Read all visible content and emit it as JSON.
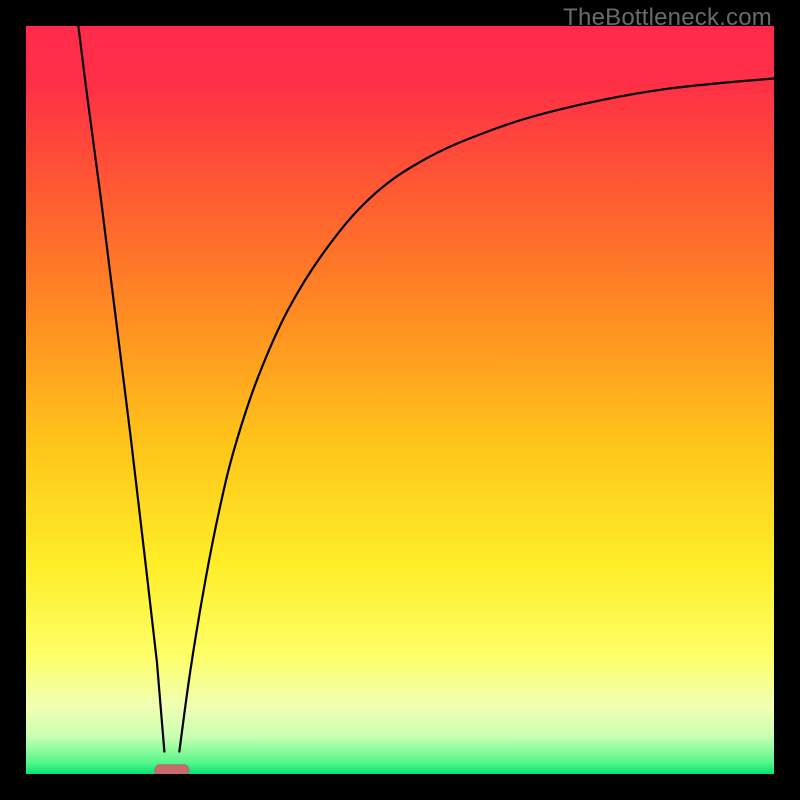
{
  "watermark": "TheBottleneck.com",
  "colors": {
    "frame": "#000000",
    "curve": "#000000",
    "marker_fill": "#c96a6d",
    "marker_stroke": "#a97067",
    "gradient_stops": [
      {
        "offset": "0%",
        "color": "#ff2a4c"
      },
      {
        "offset": "8%",
        "color": "#ff3046"
      },
      {
        "offset": "22%",
        "color": "#ff5a32"
      },
      {
        "offset": "38%",
        "color": "#ff8a23"
      },
      {
        "offset": "55%",
        "color": "#ffc21a"
      },
      {
        "offset": "72%",
        "color": "#ffee28"
      },
      {
        "offset": "84%",
        "color": "#feff66"
      },
      {
        "offset": "91%",
        "color": "#f1ffb4"
      },
      {
        "offset": "95%",
        "color": "#c8ffb1"
      },
      {
        "offset": "98.5%",
        "color": "#55f58a"
      },
      {
        "offset": "100%",
        "color": "#00e572"
      }
    ]
  },
  "chart_data": {
    "type": "line",
    "title": "",
    "xlabel": "",
    "ylabel": "",
    "xlim": [
      0,
      100
    ],
    "ylim": [
      0,
      100
    ],
    "legend": false,
    "annotations": [
      "TheBottleneck.com"
    ],
    "marker": {
      "x": 19.5,
      "y": 0.5,
      "shape": "rounded-pill"
    },
    "series": [
      {
        "name": "left-branch",
        "comment": "Steep descending line from top-left toward the minimum pill",
        "x": [
          7,
          8,
          10,
          12,
          14,
          16,
          17.5,
          18.5
        ],
        "y": [
          100,
          92,
          77,
          61,
          45,
          28,
          15,
          3
        ]
      },
      {
        "name": "right-branch",
        "comment": "Rising saturating curve from the minimum toward upper-right",
        "x": [
          20.5,
          22,
          24,
          26,
          28,
          31,
          35,
          40,
          46,
          53,
          62,
          72,
          85,
          100
        ],
        "y": [
          3,
          14,
          26,
          36,
          44,
          53,
          62,
          70,
          77,
          82,
          86,
          89,
          91.5,
          93
        ]
      }
    ]
  }
}
